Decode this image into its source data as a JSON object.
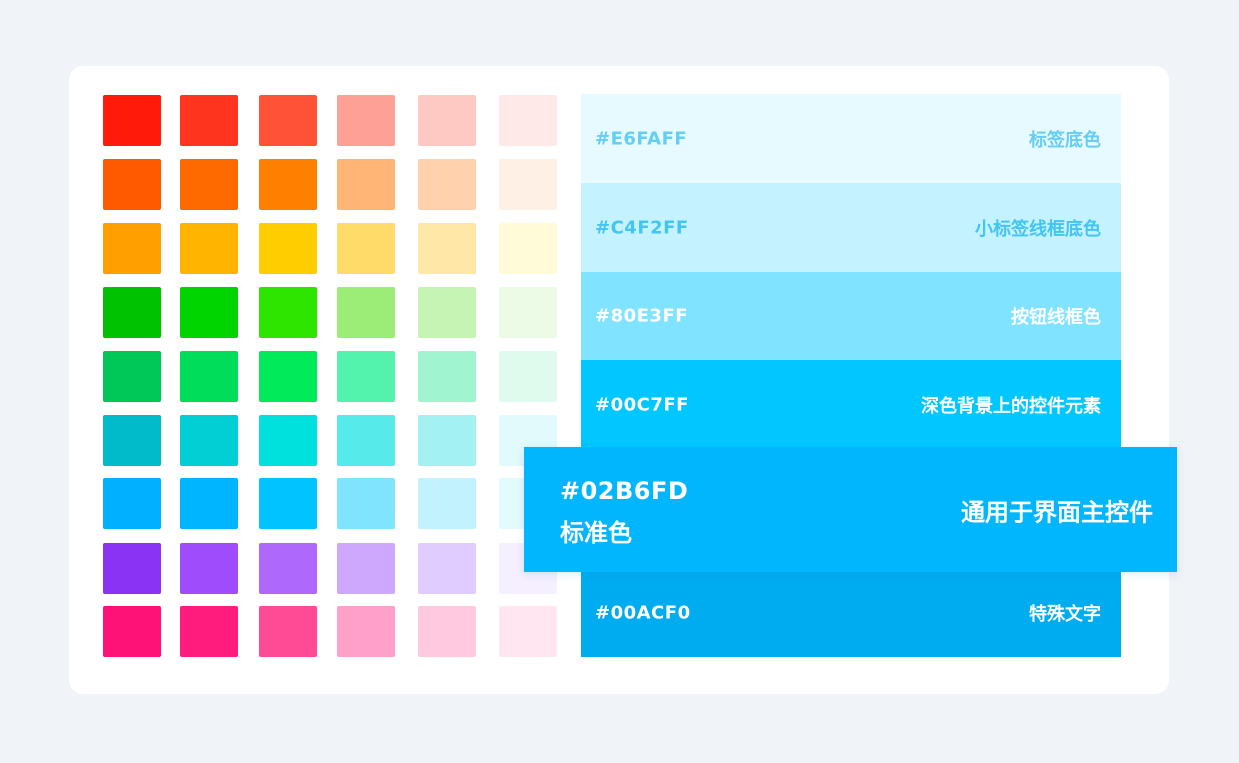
{
  "palette": {
    "rows": [
      [
        "#ff1a0a",
        "#ff3520",
        "#ff5237",
        "#ffa096",
        "#ffc9c3",
        "#ffe9e8"
      ],
      [
        "#ff5a00",
        "#ff6a00",
        "#ff7f00",
        "#ffb576",
        "#ffd2ad",
        "#fff0e5"
      ],
      [
        "#ff9f00",
        "#ffb500",
        "#ffcd00",
        "#ffdb6a",
        "#ffe7a8",
        "#fffad8"
      ],
      [
        "#00c200",
        "#00d500",
        "#2ee500",
        "#9ced78",
        "#c6f4b4",
        "#ebfbe5"
      ],
      [
        "#00c857",
        "#00dd5a",
        "#00ea59",
        "#53f2ad",
        "#a0f5d0",
        "#dffbee"
      ],
      [
        "#00bbc9",
        "#00cfd3",
        "#00e1de",
        "#57eaeb",
        "#a3f2f1",
        "#e2fafb"
      ],
      [
        "#00b1ff",
        "#00b5ff",
        "#00c3ff",
        "#80e4fe",
        "#c2f2fe",
        "#e3faff"
      ],
      [
        "#8a33f5",
        "#9f4cfc",
        "#ae68fb",
        "#cda8fd",
        "#e1ccff",
        "#f5efff"
      ],
      [
        "#ff1277",
        "#ff1c7d",
        "#ff4b96",
        "#ffa0c8",
        "#ffcae0",
        "#ffe6f0"
      ]
    ]
  },
  "bands": [
    {
      "hex": "#E6FAFF",
      "label": "标签底色",
      "bg": "#e6faff",
      "fg": "#64cef4"
    },
    {
      "hex": "#C4F2FF",
      "label": "小标签线框底色",
      "bg": "#c4f2ff",
      "fg": "#42c5f2"
    },
    {
      "hex": "#80E3FF",
      "label": "按钮线框色",
      "bg": "#80e3ff",
      "fg": "#ffffff"
    },
    {
      "hex": "#00C7FF",
      "label": "深色背景上的控件元素",
      "bg": "#00c7ff",
      "fg": "#ffffff"
    },
    {
      "hex": "#00ACF0",
      "label": "特殊文字",
      "bg": "#00acf0",
      "fg": "#ffffff"
    }
  ],
  "primary": {
    "hex": "#02B6FD",
    "name": "标准色",
    "label": "通用于界面主控件",
    "bg": "#02b6fd"
  }
}
